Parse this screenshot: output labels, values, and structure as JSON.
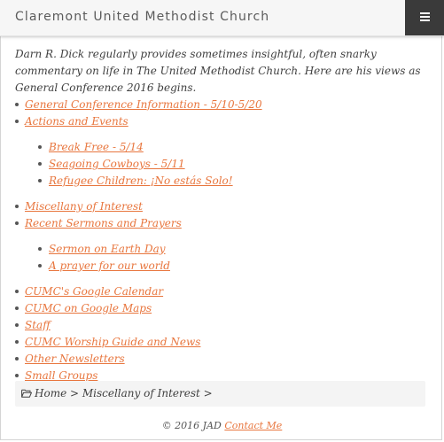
{
  "header": {
    "site_title": "Claremont United Methodist Church",
    "menu_icon": "hamburger-icon"
  },
  "intro": "Darn R. Dick regularly provides sometimes insightful, often snarky commentary on life in The United Methodist Church. Here are his views as General Conference 2016 begins.",
  "nav": {
    "general_conference": "General Conference Information - 5/10-5/20",
    "actions_events": "Actions and Events",
    "actions_sub": [
      "Break Free - 5/14",
      "Seagoing Cowboys - 5/11",
      "Refugee Children: ¡No estás Solo!"
    ],
    "miscellany": "Miscellany of Interest",
    "sermons": "Recent Sermons and Prayers",
    "sermons_sub": [
      "Sermon on Earth Day",
      "A prayer for our world"
    ],
    "rest": [
      "CUMC's Google Calendar",
      "CUMC on Google Maps",
      "Staff",
      "CUMC Worship Guide and News",
      "Other Newsletters",
      "Small Groups"
    ]
  },
  "breadcrumb": {
    "icon": "folder-open-icon",
    "home": "Home",
    "sep1": " > ",
    "current": "Miscellany of Interest",
    "sep2": " >"
  },
  "footer": {
    "copyright": "© 2016 JAD",
    "contact": "Contact Me"
  },
  "colors": {
    "link": "#e8763e",
    "header_bg": "#f6f6f6",
    "menu_bg": "#3a3a3a",
    "breadcrumb_bg": "#f4f4f4"
  }
}
